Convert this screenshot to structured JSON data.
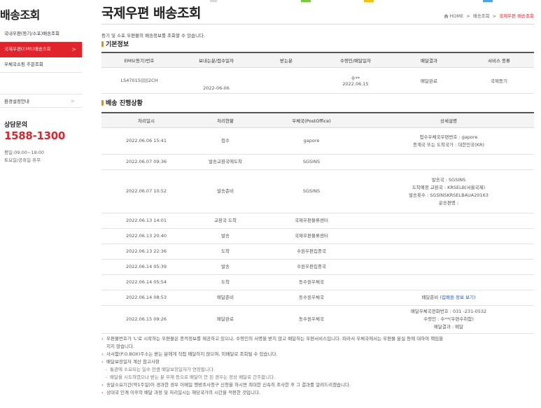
{
  "sidebar": {
    "title": "배송조회",
    "items": [
      {
        "label": "국내우편(등기/소포)배송조회",
        "active": false
      },
      {
        "label": "국제우편(EMS)배송조회",
        "active": true
      },
      {
        "label": "우체국쇼핑 주문조회",
        "active": false
      }
    ],
    "active_arrow": ">",
    "guide": "환경설정안내",
    "guide_arrow": ">",
    "consult_label": "상담문의",
    "consult_phone": "1588-1300",
    "hours_weekday": "평일:09:00~18:00",
    "hours_weekend": "토요일/공휴일 휴무"
  },
  "header": {
    "title": "국제우편 배송조회",
    "breadcrumb": [
      "HOME",
      "배송조회",
      "국제우편 배송조회"
    ],
    "breadcrumb_sep": ">"
  },
  "intro": "등기 및 소포 우편물의 배송정보를 조회할 수 있습니다.",
  "basic": {
    "heading": "기본정보",
    "columns": [
      "EMS(등기)번호",
      "보내는분/접수일자",
      "받는분",
      "수령인/배달일자",
      "배달결과",
      "서비스 종류"
    ],
    "row": {
      "ems_no_prefix": "LS47015",
      "ems_no_suffix": "2CH",
      "accept_date": "2022-06-06",
      "receiver": "",
      "recipient_name": "수**",
      "delivery_date": "2022.06.15",
      "result": "배달완료",
      "service": "국제등기"
    }
  },
  "progress": {
    "heading": "배송 진행상황",
    "columns": [
      "처리일시",
      "처리현황",
      "우체국(PostOffice)",
      "상세설명"
    ],
    "rows": [
      {
        "datetime": "2022.06.06 15:41",
        "status": "접수",
        "office": "gapore",
        "detail": [
          "접수우체국우편번호 : gapore",
          "종계국 또는 도착국가 : 대한민국(KR)"
        ]
      },
      {
        "datetime": "2022.06.07 09:36",
        "status": "발송교환국에도착",
        "office": "SGSINS",
        "detail": []
      },
      {
        "datetime": "2022.06.07 10:52",
        "status": "발송준비",
        "office": "SGSINS",
        "detail": [
          "발송국 : SGSINS",
          "도착예정 교환국 : KRSELB(서울국제)",
          "발송횟수 : SGSINSKRSELBAUA20163",
          "운송편명 :"
        ]
      },
      {
        "datetime": "2022.06.13 14:01",
        "status": "교환국 도착",
        "office": "국제우편물류센터",
        "detail": []
      },
      {
        "datetime": "2022.06.13 20:40",
        "status": "발송",
        "office": "국제우편물류센터",
        "detail": []
      },
      {
        "datetime": "2022.06.13 22:36",
        "status": "도착",
        "office": "수원우편집중국",
        "detail": []
      },
      {
        "datetime": "2022.06.14 05:39",
        "status": "발송",
        "office": "수원우편집중국",
        "detail": []
      },
      {
        "datetime": "2022.06.14 05:54",
        "status": "도착",
        "office": "동수원우체국",
        "detail": []
      },
      {
        "datetime": "2022.06.14 08:53",
        "status": "배달준비",
        "office": "동수원우체국",
        "detail": [
          "배달준비 "
        ],
        "detail_link": "(집배원 정보 보기)"
      },
      {
        "datetime": "2022.06.15 09:26",
        "status": "배달완료",
        "office": "동수원우체국",
        "detail": [
          "배달우체국전화번호 : 031 -231-0532",
          "수령인 : 수**(우편수취함)",
          "배달결과 : 배달"
        ]
      }
    ]
  },
  "notes": [
    {
      "type": "n",
      "text": "우편물번호가 'L'로 시작하는 우편물은 종적정보를 제공하고 있으나, 수령인의 서명을 받지 않고 배달하는 우편서비스입니다. 따라서 우체국에서는 우편물 분실 등에 대하여 책임을"
    },
    {
      "type": "cont",
      "text": "지지 않습니다."
    },
    {
      "type": "n",
      "text": "사서함(P.O.BOX)주소는 받는 분에게 직접 배달하지 않으며, 미배달로 조회될 수 있습니다."
    },
    {
      "type": "n",
      "text": "배달보장일자 계산 참고사항"
    },
    {
      "type": "sub",
      "text": "통관에 소요되는 일수 만큼 배달보장일자가 연장됩니다."
    },
    {
      "type": "sub",
      "text": "배달을 시도하였으나 받는 분 부재 등으로 배달이 안 된 경우는 정상 배달로 간주합니다."
    },
    {
      "type": "n",
      "text": "송달소요기간(약1주일)이 경과한 경우 이메일 행방조사청구 신청을 하시면 최대한 신속히 조사한 후 그 결과를 알려드리겠습니다."
    },
    {
      "type": "n",
      "text": "상대국 인계 이후의 배달 과정 및 처리일시는 해당국가의 시간을 적용한 것입니다."
    }
  ],
  "colors": {
    "accent": "#e0242c",
    "section_mark": "#f08c00",
    "link": "#1a56c9"
  },
  "icons": {
    "home": "home-icon"
  }
}
